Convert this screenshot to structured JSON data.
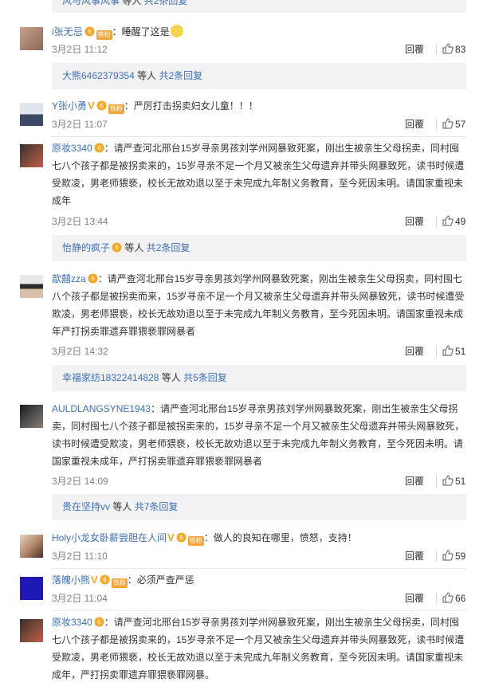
{
  "top_reply": {
    "user": "风与风事风事",
    "mid": "等人",
    "more": "共2条回复"
  },
  "comments": [
    {
      "user": "i张无忌",
      "badge": "铁粉",
      "has_v": false,
      "text": "：睡醒了这是",
      "emoji": "doge-emoji",
      "time": "3月2日 11:12",
      "reply_label": "回覆",
      "likes": "83",
      "sub": {
        "user": "大熊6462379354",
        "mid": "等人",
        "more": "共2条回复"
      }
    },
    {
      "user": "Y张小勇",
      "badge": "铁粉",
      "has_v": true,
      "text": "：严厉打击拐卖妇女儿童！！！",
      "time": "3月2日 11:07",
      "reply_label": "回覆",
      "likes": "57"
    },
    {
      "user": "原妆3340",
      "badge": "",
      "has_v": false,
      "text": "：请严查河北邢台15岁寻亲男孩刘学州网暴致死案，刚出生被亲生父母拐卖，同村囤七八个孩子都是被拐卖来的，15岁寻亲不足一个月又被亲生父母遗弃并带头网暴致死，读书时候遭受欺凌，男老师猥亵，校长无故劝退以至于未完成九年制义务教育，至今死因未明。请国家重视未成年",
      "time": "3月2日 13:44",
      "reply_label": "回覆",
      "likes": "49",
      "sub": {
        "user": "怡静的疯子",
        "mid": "等人",
        "more": "共2条回复"
      }
    },
    {
      "user": "歆囍zza",
      "badge": "",
      "has_v": false,
      "text": "：请严查河北邢台15岁寻亲男孩刘学州网暴致死案，刚出生被亲生父母拐卖，同村囤七八个孩子都是被拐卖而来，15岁寻亲不足一个月又被亲生父母遗弃并带头网暴致死，读书时候遭受欺凌，男老师猥亵，校长无故劝退以至于未完成九年制义务教育，至今死因未明。请国家重视未成年严打拐卖罪遗弃罪猥亵罪网暴者",
      "time": "3月2日 14:32",
      "reply_label": "回覆",
      "likes": "51",
      "sub": {
        "user": "幸福家纺18322414828",
        "mid": "等人",
        "more": "共5条回复"
      }
    },
    {
      "user": "AULDLANGSYNE1943",
      "badge": "",
      "has_v": false,
      "text": "：请严查河北邢台15岁寻亲男孩刘学州网暴致死案，刚出生被亲生父母拐卖，同村囤七八个孩子都是被拐卖来的，15岁寻亲不足一个月又被亲生父母遗弃并带头网暴致死，读书时候遭受欺凌，男老师猥亵，校长无故劝退以至于未完成九年制义务教育，至今死因未明。请国家重视未成年，严打拐卖罪遗弃罪猥亵罪网暴者",
      "time": "3月2日 14:09",
      "reply_label": "回覆",
      "likes": "51",
      "sub": {
        "user": "贵在坚持vv",
        "mid": "等人",
        "more": "共7条回复"
      }
    },
    {
      "user": "Holy小龙女卧薪尝胆在人间",
      "badge": "铁粉",
      "has_v": true,
      "text": "：做人的良知在哪里，愤怒，支持！",
      "time": "3月2日 11:10",
      "reply_label": "回覆",
      "likes": "59"
    },
    {
      "user": "落魄小熊",
      "badge": "铁粉",
      "has_v": true,
      "text": "：必须严查严惩",
      "time": "3月2日 11:04",
      "reply_label": "回覆",
      "likes": "66"
    },
    {
      "user": "原妆3340",
      "badge": "",
      "has_v": false,
      "text": "：请严查河北邢台15岁寻亲男孩刘学州网暴致死案，刚出生被亲生父母拐卖，同村囤七八个孩子都是被拐卖来的，15岁寻亲不足一个月又被亲生父母遗弃并带头网暴致死，读书时候遭受欺凌，男老师猥亵，校长无故劝退以至于未完成九年制义务教育，至今死因未明。请国家重视未成年，严打拐卖罪遗弃罪猥亵罪网暴。"
    }
  ],
  "colors": {
    "link": "#3f70b5",
    "reply_bg": "#f2f2f5",
    "meta": "#808080",
    "badge": "#f3a53b"
  }
}
